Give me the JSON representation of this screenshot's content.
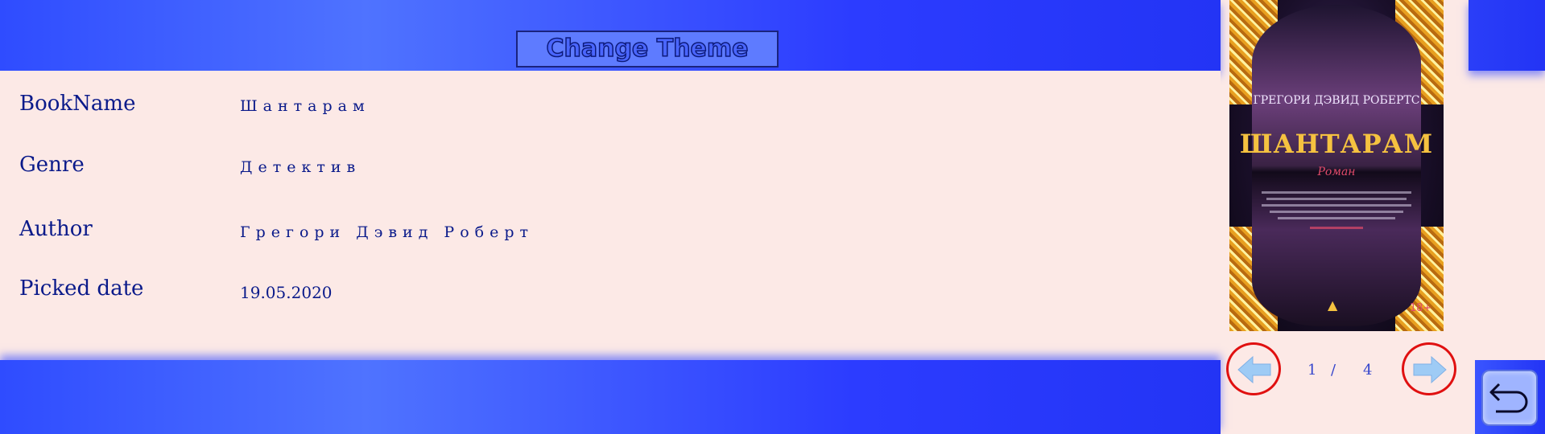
{
  "header": {
    "theme_button_label": "Change Theme"
  },
  "details": {
    "book_name_label": "BookName",
    "book_name_value": "Шантарам",
    "genre_label": "Genre",
    "genre_value": "Детектив",
    "author_label": "Author",
    "author_value": "Грегори Дэвид Роберт",
    "picked_date_label": "Picked date",
    "picked_date_value": "19.05.2020"
  },
  "cover": {
    "author": "ГРЕГОРИ ДЭВИД РОБЕРТС",
    "title": "ШАНТАРАМ",
    "subtitle": "Роман",
    "age": "18+"
  },
  "pager": {
    "current": "1",
    "separator": "/",
    "total": "4"
  },
  "colors": {
    "band": "#2f4cff",
    "panel": "#fce9e6",
    "text": "#0a1a8a",
    "nav_ring": "#e01010"
  },
  "icons": {
    "prev": "arrow-left-icon",
    "next": "arrow-right-icon",
    "back": "return-arrow-icon"
  }
}
